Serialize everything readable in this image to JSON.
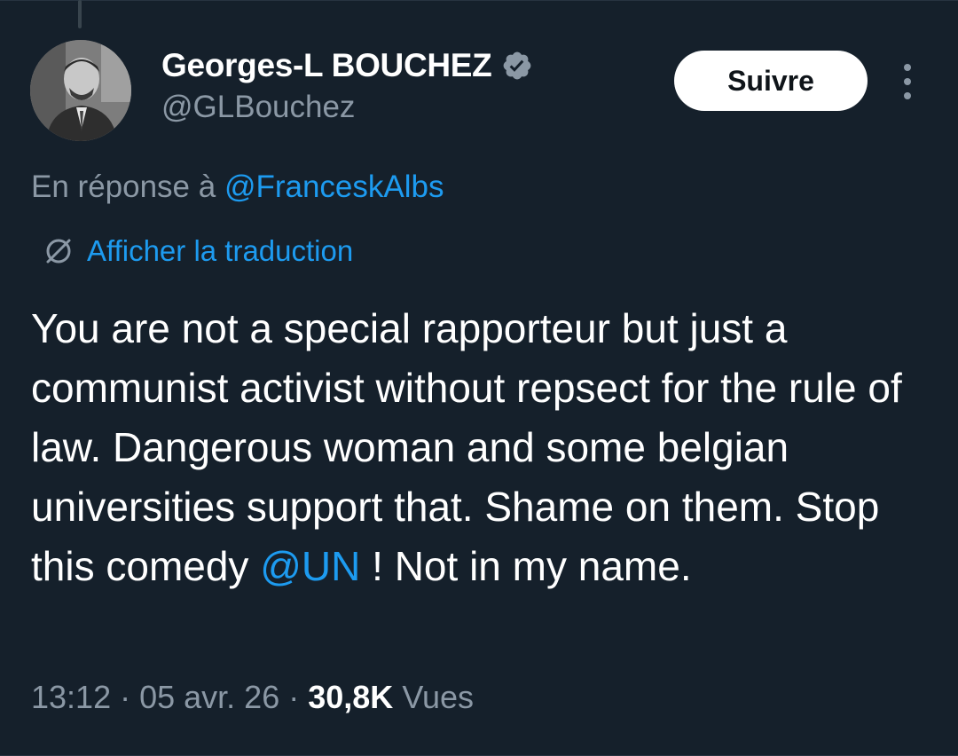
{
  "author": {
    "display_name": "Georges-L BOUCHEZ",
    "handle": "@GLBouchez",
    "verified": true,
    "avatar": "profile-photo"
  },
  "actions": {
    "follow_label": "Suivre",
    "more_icon": "more-vertical-icon"
  },
  "reply": {
    "prefix": "En réponse à ",
    "mention": "@FranceskAlbs"
  },
  "translate": {
    "icon": "globe-translate-icon",
    "label": "Afficher la traduction"
  },
  "tweet": {
    "text_part1": "You are not a special rapporteur but just a communist activist without repsect for the rule of law. Dangerous woman and some belgian universities support that. Shame on them. Stop this comedy ",
    "mention": "@UN",
    "text_part2": " ! Not in my name."
  },
  "meta": {
    "time": "13:12",
    "separator": " · ",
    "date": "05 avr. 26",
    "views_count": "30,8K",
    "views_label": "Vues"
  },
  "colors": {
    "background": "#15202b",
    "accent": "#1d9bf0",
    "muted": "#8b98a5",
    "text": "#ffffff"
  }
}
